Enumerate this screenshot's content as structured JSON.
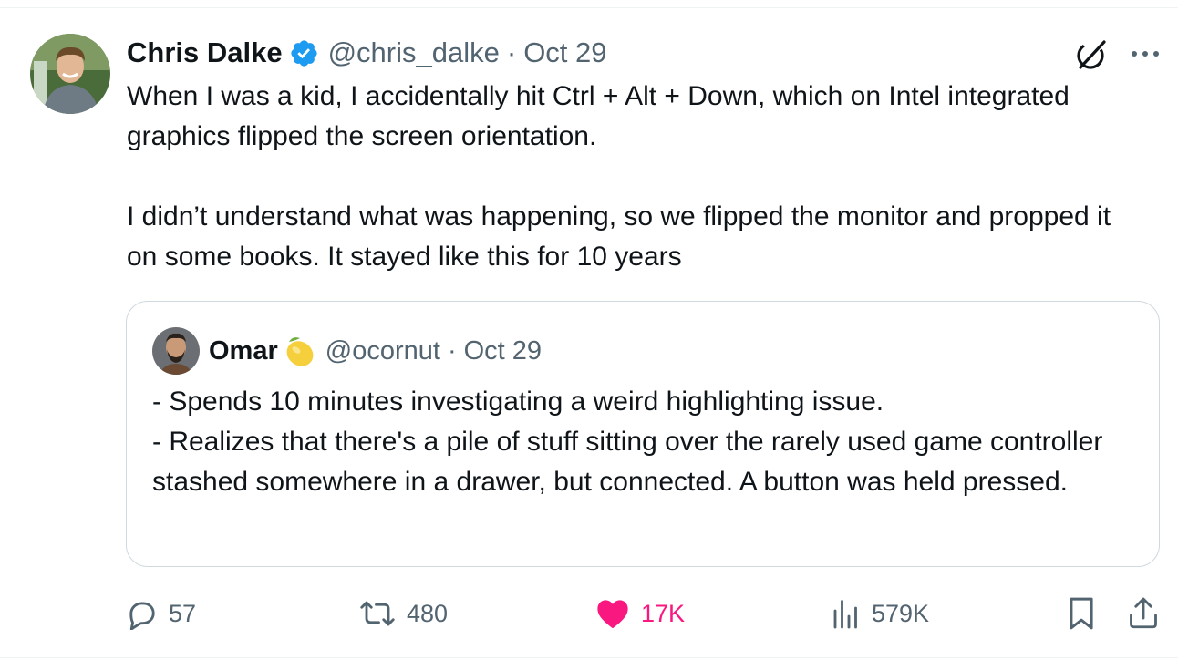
{
  "tweet": {
    "author_name": "Chris Dalke",
    "handle": "@chris_dalke",
    "separator": "·",
    "date": "Oct 29",
    "text": "When I was a kid, I accidentally hit Ctrl + Alt + Down, which on Intel integrated graphics flipped the screen orientation.\n\nI didn’t understand what was happening, so we flipped the monitor and propped it on some books. It stayed like this for 10 years"
  },
  "quote": {
    "author_name": "Omar",
    "emoji": "lemon",
    "handle": "@ocornut",
    "separator": "·",
    "date": "Oct 29",
    "text": "- Spends 10 minutes investigating a weird highlighting issue.\n- Realizes that there's a pile of stuff sitting over the rarely used game controller stashed somewhere in a drawer, but connected. A button was held pressed."
  },
  "actions": {
    "replies": "57",
    "reposts": "480",
    "likes": "17K",
    "views": "579K"
  },
  "icons": {
    "verified": "verified-badge-icon",
    "grok": "grok-icon",
    "more": "more-icon",
    "reply": "reply-icon",
    "repost": "repost-icon",
    "like": "heart-icon",
    "views": "views-icon",
    "bookmark": "bookmark-icon",
    "share": "share-icon"
  },
  "colors": {
    "verified_blue": "#1d9bf0",
    "like_pink": "#f91880",
    "secondary_text": "#536471",
    "primary_text": "#0f1419",
    "border": "#cfd9de"
  }
}
